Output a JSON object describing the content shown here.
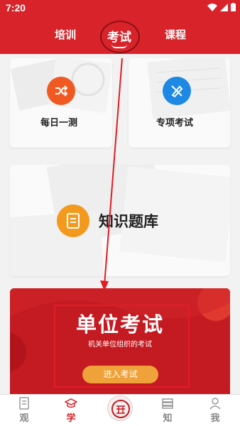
{
  "status": {
    "time": "7:20"
  },
  "tabs": {
    "left": "培训",
    "active": "考试",
    "right": "课程"
  },
  "cards": {
    "daily": "每日一测",
    "special": "专项考试",
    "bank": "知识题库"
  },
  "banner": {
    "title": "单位考试",
    "subtitle": "机关单位组织的考试",
    "button": "进入考试"
  },
  "nav": {
    "items": [
      {
        "label": "观"
      },
      {
        "label": "学"
      },
      {
        "label": "知"
      },
      {
        "label": "我"
      }
    ]
  },
  "colors": {
    "brand_red": "#d8232a",
    "daily_icon": "#f05a22",
    "special_icon": "#1e88e5",
    "bank_icon": "#f39a1e",
    "button": "#f0a23a"
  }
}
